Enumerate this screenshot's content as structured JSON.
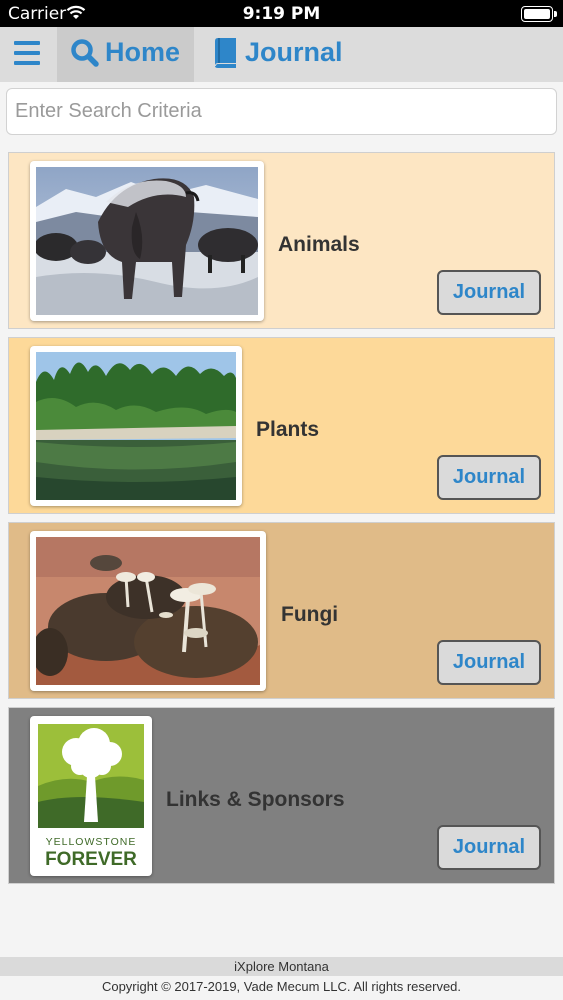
{
  "status_bar": {
    "carrier": "Carrier",
    "time": "9:19 PM",
    "wifi_icon": "wifi-icon",
    "battery_icon": "battery-icon"
  },
  "nav": {
    "menu_icon": "hamburger-menu-icon",
    "home_label": "Home",
    "home_icon": "search-icon",
    "journal_label": "Journal",
    "journal_icon": "book-icon",
    "accent_color": "#2e86c9"
  },
  "search": {
    "placeholder": "Enter Search Criteria",
    "value": ""
  },
  "categories": [
    {
      "title": "Animals",
      "button_label": "Journal",
      "background": "#fde6c3",
      "image": "bison-photo"
    },
    {
      "title": "Plants",
      "button_label": "Journal",
      "background": "#fdd999",
      "image": "forest-lake-photo"
    },
    {
      "title": "Fungi",
      "button_label": "Journal",
      "background": "#e0bb88",
      "image": "mushrooms-photo"
    },
    {
      "title": "Links & Sponsors",
      "button_label": "Journal",
      "background": "#808080",
      "image": "yellowstone-forever-logo"
    }
  ],
  "logo_text": {
    "line1": "YELLOWSTONE",
    "line2": "FOREVER"
  },
  "footer": {
    "app_name": "iXplore Montana",
    "copyright": "Copyright © 2017-2019, Vade Mecum LLC. All rights reserved."
  }
}
